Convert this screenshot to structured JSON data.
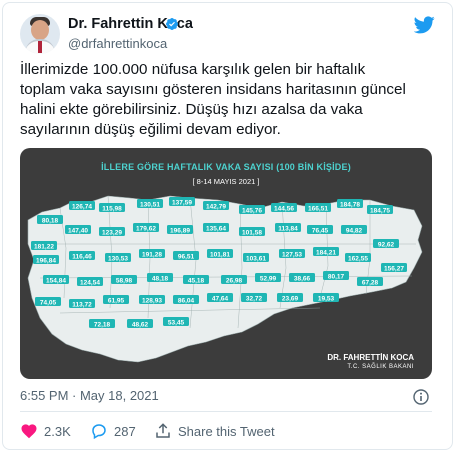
{
  "author": {
    "name": "Dr. Fahrettin Koca",
    "handle": "@drfahrettinkoca"
  },
  "tweet": {
    "text": "İllerimizde 100.000 nüfusa karşılık gelen bir haftalık\ntoplam vaka sayısını gösteren insidans haritasının güncel\nhalini ekte görebilirsiniz. Düşüş hızı azalsa da vaka\nsayılarının düşüş eğilimi devam ediyor.",
    "timestamp": "6:55 PM · May 18, 2021"
  },
  "media": {
    "title": "İLLERE GÖRE HAFTALIK VAKA SAYISI (100 BİN KİŞİDE)",
    "date_range": "[ 8-14 MAYIS 2021 ]",
    "signature": "DR. FAHRETTİN KOCA",
    "signature_sub": "T.C. SAĞLIK BAKANI",
    "values": [
      "80,18",
      "126,74",
      "115,98",
      "130,51",
      "137,59",
      "142,79",
      "145,76",
      "144,56",
      "166,51",
      "184,78",
      "184,75",
      "181,22",
      "147,40",
      "123,29",
      "179,62",
      "196,89",
      "135,64",
      "101,58",
      "113,84",
      "76,45",
      "94,82",
      "92,62",
      "196,84",
      "116,46",
      "130,53",
      "191,28",
      "96,51",
      "101,81",
      "103,61",
      "127,53",
      "184,21",
      "162,55",
      "156,27",
      "154,84",
      "124,54",
      "58,98",
      "48,18",
      "45,18",
      "26,98",
      "52,99",
      "38,66",
      "80,17",
      "67,28",
      "74,05",
      "113,72",
      "61,95",
      "128,93",
      "86,04",
      "47,64",
      "32,72",
      "23,69",
      "19,53",
      "72,18",
      "48,62",
      "53,45"
    ]
  },
  "actions": {
    "likes": "2.3K",
    "replies": "287",
    "share_label": "Share this Tweet"
  },
  "colors": {
    "twitter_blue": "#1d9bf0",
    "map_background": "#3c3c3c",
    "map_region": "#e9eeee",
    "badge": "#1fb6b4"
  }
}
